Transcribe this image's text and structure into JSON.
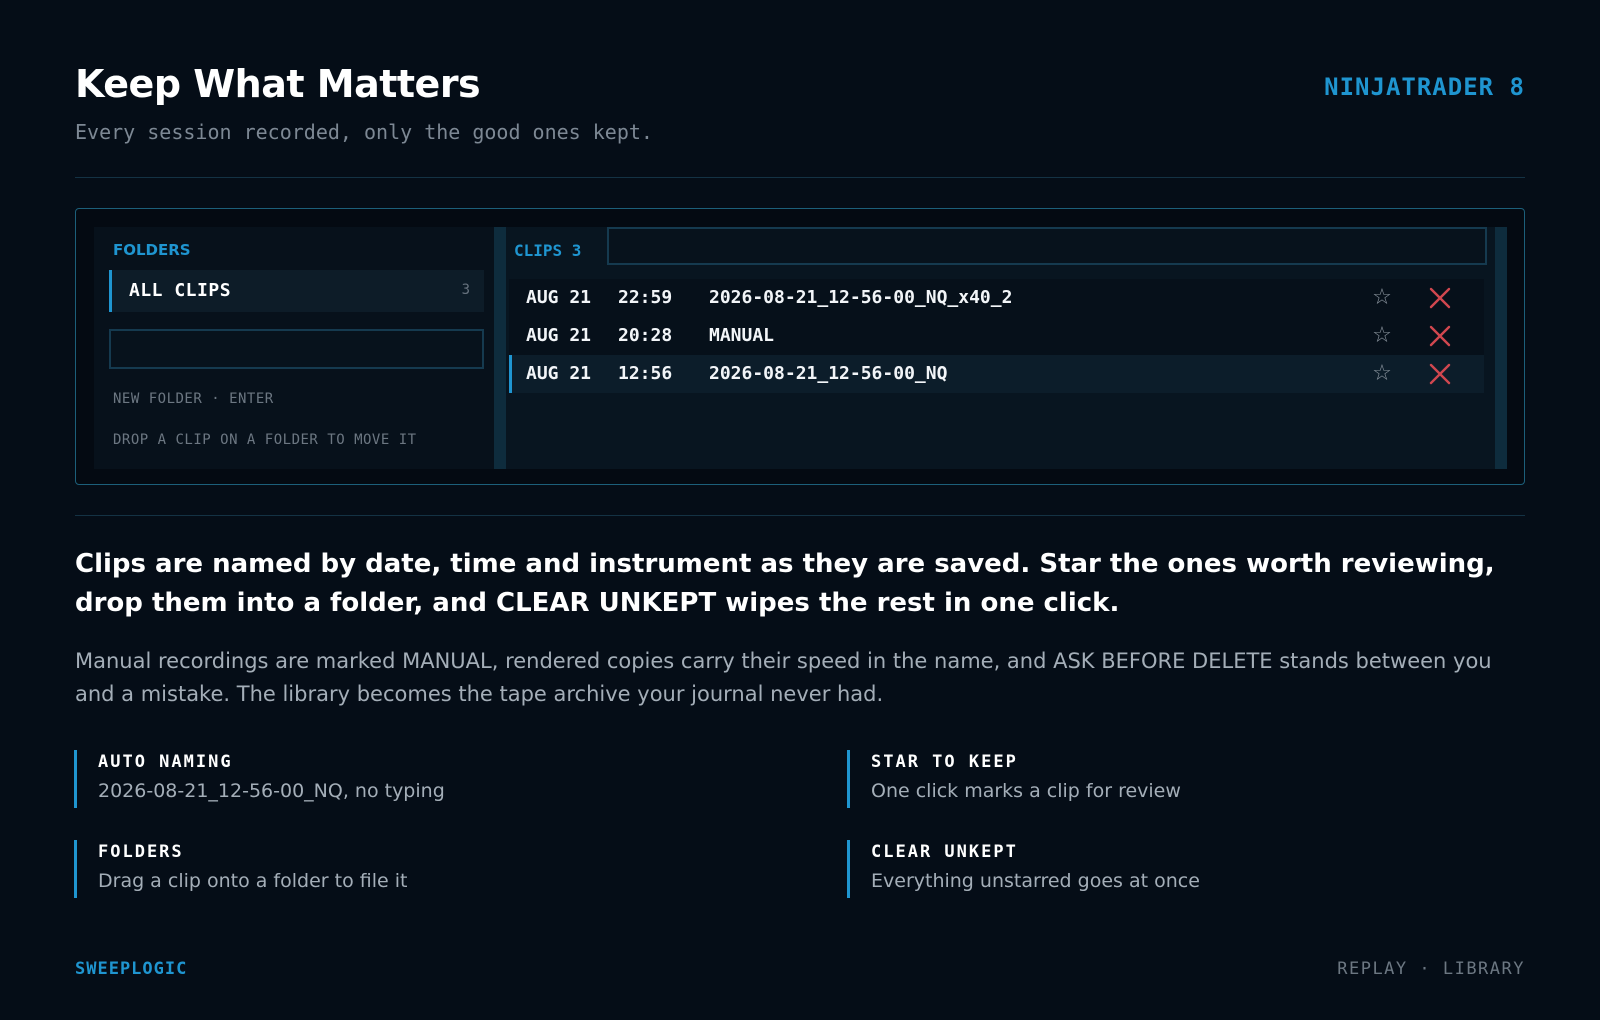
{
  "header": {
    "title": "Keep What Matters",
    "subtitle": "Every session recorded, only the good ones kept.",
    "brand": "NINJATRADER 8"
  },
  "app": {
    "folders": {
      "heading": "FOLDERS",
      "items": [
        {
          "label": "ALL CLIPS",
          "count": "3"
        }
      ],
      "new_folder_value": "",
      "hint_new_folder": "NEW FOLDER · ENTER",
      "hint_drop": "DROP A CLIP ON A FOLDER TO MOVE IT"
    },
    "clips": {
      "heading": "CLIPS 3",
      "search_value": "",
      "rows": [
        {
          "date": "AUG 21",
          "time": "22:59",
          "name": "2026-08-21_12-56-00_NQ_x40_2"
        },
        {
          "date": "AUG 21",
          "time": "20:28",
          "name": "MANUAL"
        },
        {
          "date": "AUG 21",
          "time": "12:56",
          "name": "2026-08-21_12-56-00_NQ"
        }
      ],
      "star_glyph": "☆",
      "icons": {
        "star": "star-icon",
        "delete": "close-icon"
      }
    }
  },
  "content": {
    "lead": "Clips are named by date, time and instrument as they are saved. Star the ones worth reviewing, drop them into a folder, and CLEAR UNKEPT wipes the rest in one click.",
    "paragraph": "Manual recordings are marked MANUAL, rendered copies carry their speed in the name, and ASK BEFORE DELETE stands between you and a mistake. The library becomes the tape archive your journal never had.",
    "features": [
      {
        "title": "AUTO NAMING",
        "desc": "2026-08-21_12-56-00_NQ, no typing"
      },
      {
        "title": "STAR TO KEEP",
        "desc": "One click marks a clip for review"
      },
      {
        "title": "FOLDERS",
        "desc": "Drag a clip onto a folder to file it"
      },
      {
        "title": "CLEAR UNKEPT",
        "desc": "Everything unstarred goes at once"
      }
    ]
  },
  "footer": {
    "left": "SWEEPLOGIC",
    "right": "REPLAY · LIBRARY"
  },
  "colors": {
    "accent": "#1f95d0",
    "background": "#050d17",
    "delete": "#d0474f"
  }
}
